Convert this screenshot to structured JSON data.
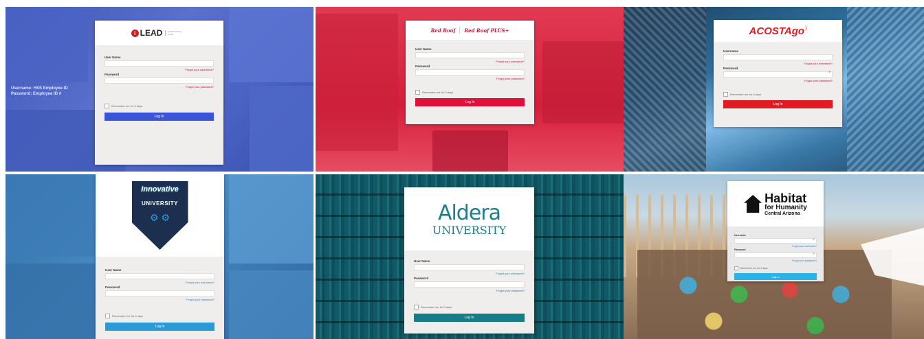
{
  "tiles": [
    {
      "id": "ilead",
      "logo_text": "LEAD",
      "logo_sub": "iLEAD learning portal",
      "hint_username": "Username: HSS Employee ID",
      "hint_password": "Password: Employee ID #",
      "username_label": "User Name",
      "password_label": "Password",
      "forgot_username": "Forgot your username?",
      "forgot_password": "Forgot your password?",
      "remember": "Remember me for 3 days",
      "login": "Log In",
      "accent": "#3a55d8"
    },
    {
      "id": "redroof",
      "logo_text_a": "Red Roof",
      "logo_text_b": "Red Roof PLUS+",
      "username_label": "User Name",
      "password_label": "Password",
      "forgot_username": "Forgot your username?",
      "forgot_password": "Forgot your password?",
      "remember": "Remember me for 3 days",
      "login": "Log In",
      "accent": "#e0103a"
    },
    {
      "id": "acosta",
      "logo_text": "ACOSTAgo",
      "username_label": "Username",
      "password_label": "Password",
      "forgot_username": "Forgot your username?",
      "forgot_password": "Forgot your password?",
      "remember": "Remember me for 3 days",
      "login": "Log In",
      "accent": "#e11b22"
    },
    {
      "id": "innovative",
      "logo_text_a": "Innovative",
      "logo_text_b": "UNIVERSITY",
      "username_label": "User Name",
      "password_label": "Password",
      "forgot_username": "Forgot your username?",
      "forgot_password": "Forgot your password?",
      "remember": "Remember me for 3 days",
      "login": "Log In",
      "accent": "#2a9ad6"
    },
    {
      "id": "aldera",
      "logo_text_a": "Aldera",
      "logo_text_b": "UNIVERSITY",
      "username_label": "User Name",
      "password_label": "Password",
      "forgot_username": "Forgot your username?",
      "forgot_password": "Forgot your password?",
      "remember": "Remember me for 3 days",
      "login": "Log In",
      "accent": "#167c86"
    },
    {
      "id": "habitat",
      "logo_text_a": "Habitat",
      "logo_text_b": "for Humanity",
      "logo_text_c": "Central Arizona",
      "username_label": "Username",
      "password_label": "Password",
      "forgot_username": "Forgot your username?",
      "forgot_password": "Forgot your password?",
      "remember": "Remember me for 3 days",
      "login": "Log In",
      "accent": "#2bb3e8"
    }
  ]
}
